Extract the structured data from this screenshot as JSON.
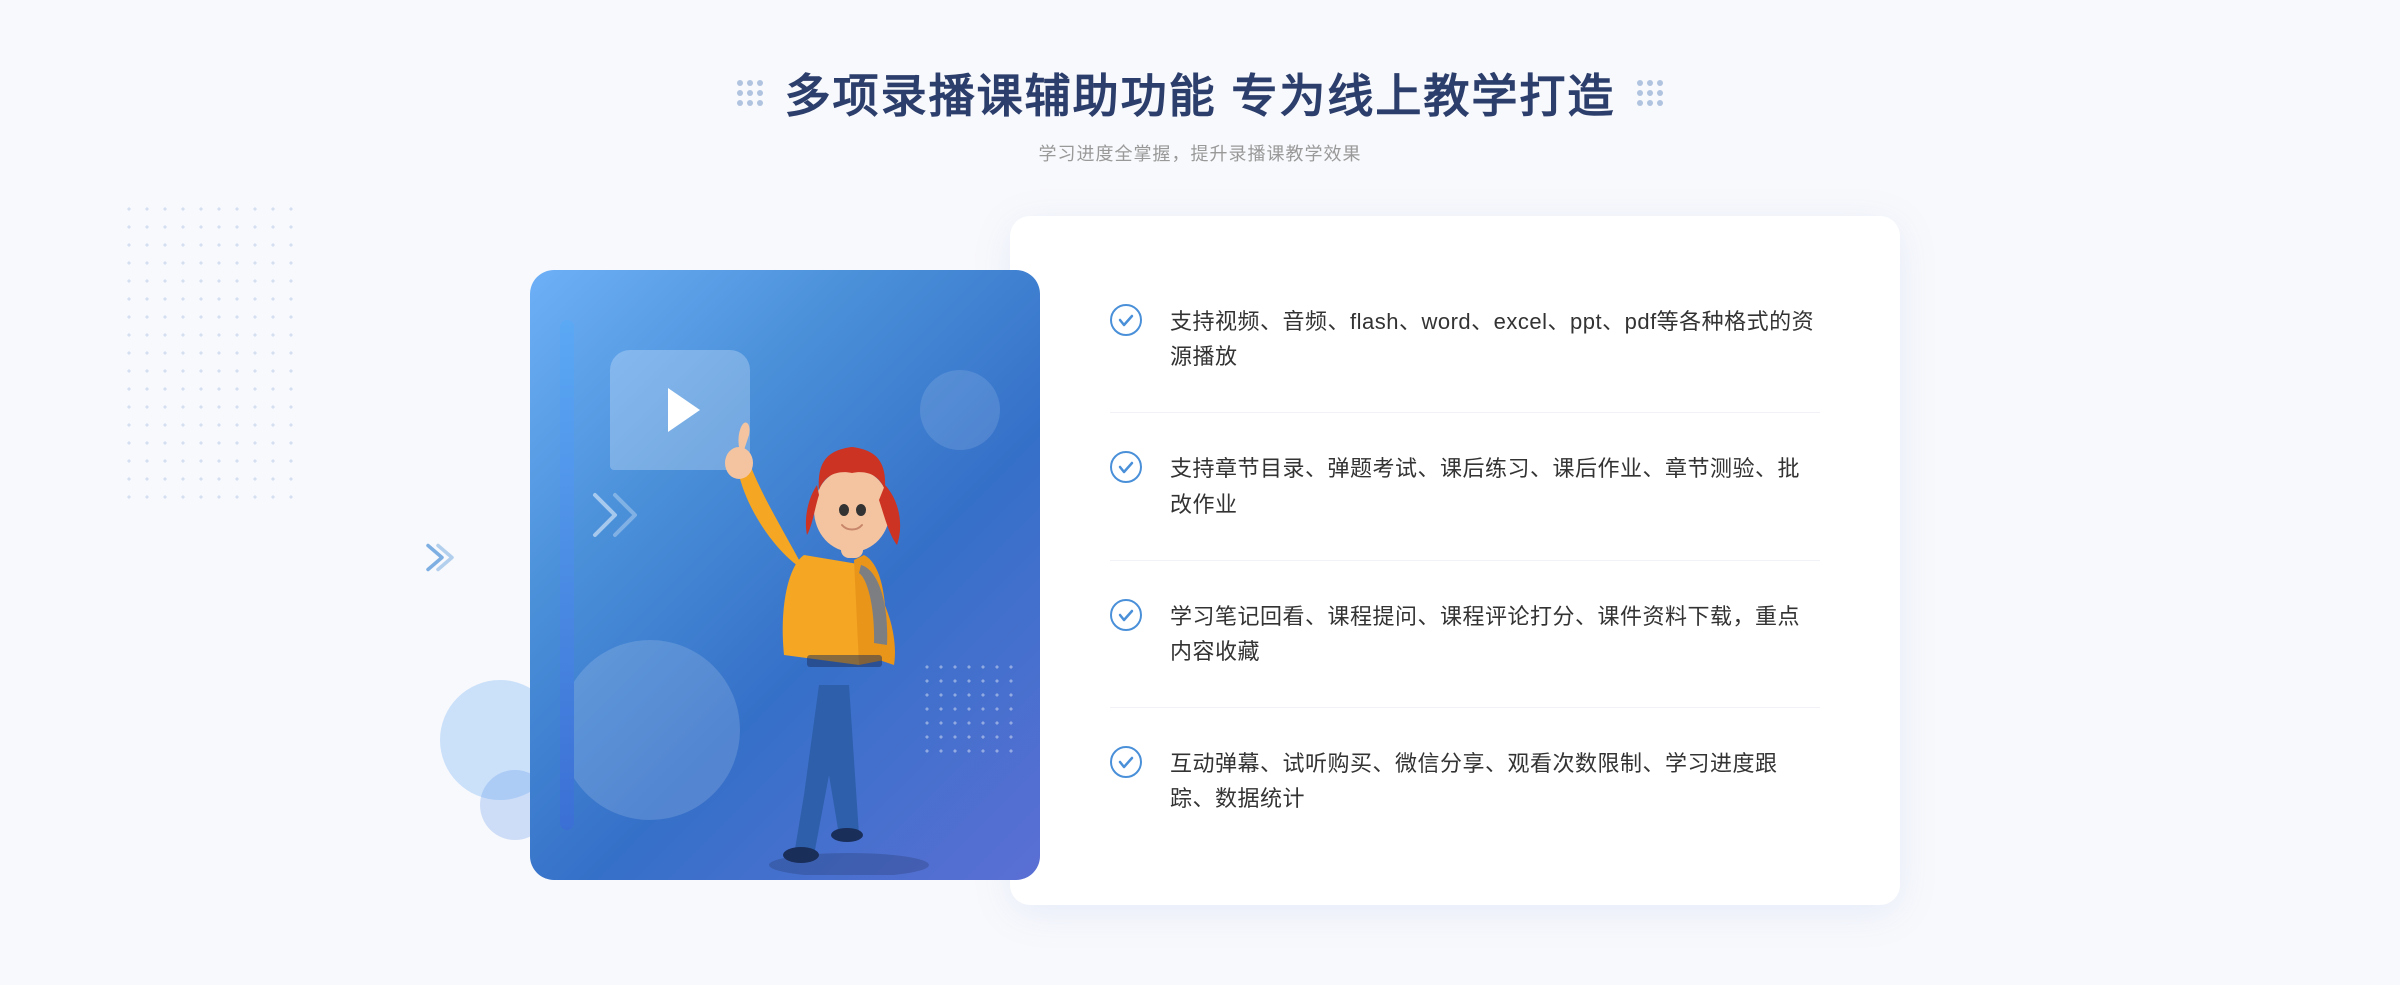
{
  "header": {
    "main_title": "多项录播课辅助功能 专为线上教学打造",
    "sub_title": "学习进度全掌握，提升录播课教学效果"
  },
  "features": [
    {
      "id": 1,
      "text": "支持视频、音频、flash、word、excel、ppt、pdf等各种格式的资源播放"
    },
    {
      "id": 2,
      "text": "支持章节目录、弹题考试、课后练习、课后作业、章节测验、批改作业"
    },
    {
      "id": 3,
      "text": "学习笔记回看、课程提问、课程评论打分、课件资料下载，重点内容收藏"
    },
    {
      "id": 4,
      "text": "互动弹幕、试听购买、微信分享、观看次数限制、学习进度跟踪、数据统计"
    }
  ]
}
